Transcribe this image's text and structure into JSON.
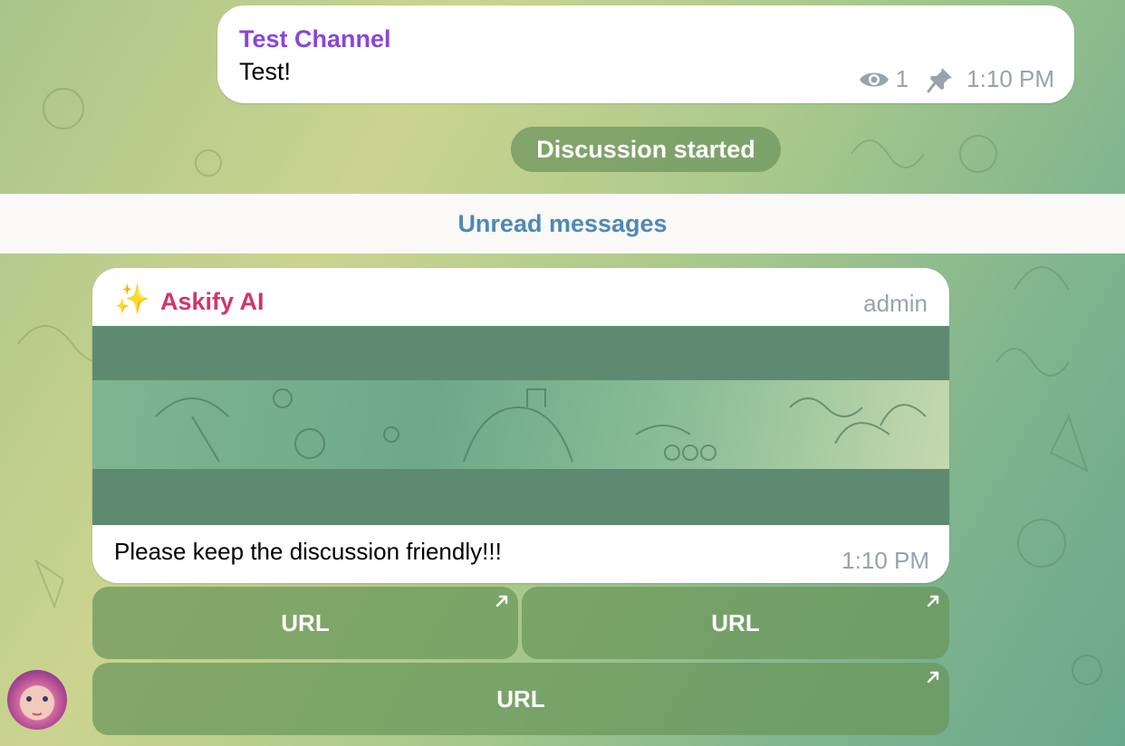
{
  "channel_post": {
    "channel_name": "Test Channel",
    "text": "Test!",
    "views": "1",
    "time": "1:10 PM",
    "icons": {
      "views": "eye-icon",
      "pin": "pin-icon"
    }
  },
  "service": {
    "label": "Discussion started"
  },
  "unread": {
    "label": "Unread messages"
  },
  "bot_message": {
    "sparkle": "✨",
    "sender": "Askify AI",
    "role": "admin",
    "text": "Please keep the discussion friendly!!!",
    "time": "1:10 PM"
  },
  "buttons": [
    {
      "label": "URL",
      "icon": "external-link-arrow-icon"
    },
    {
      "label": "URL",
      "icon": "external-link-arrow-icon"
    },
    {
      "label": "URL",
      "icon": "external-link-arrow-icon"
    }
  ],
  "colors": {
    "channel_name": "#8a45d8",
    "sender_name": "#d1356d",
    "unread_text": "#4e89b8",
    "meta_text": "#9aa2aa"
  }
}
